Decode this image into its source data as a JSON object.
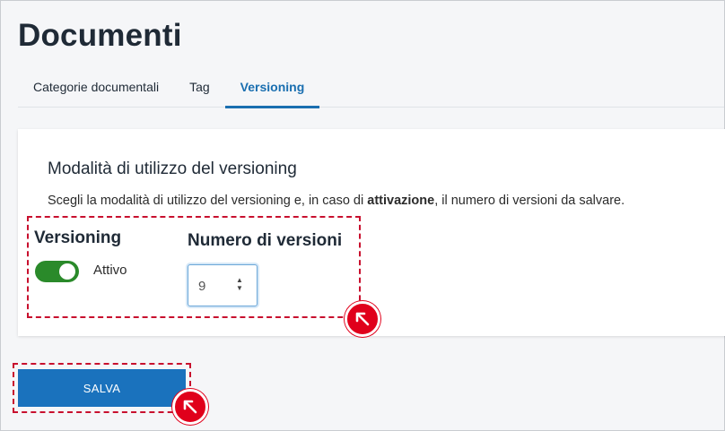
{
  "page": {
    "title": "Documenti"
  },
  "tabs": [
    {
      "label": "Categorie documentali",
      "active": false
    },
    {
      "label": "Tag",
      "active": false
    },
    {
      "label": "Versioning",
      "active": true
    }
  ],
  "card": {
    "title": "Modalità di utilizzo del versioning",
    "description_pre": "Scegli la modalità di utilizzo del versioning e, in caso di ",
    "description_bold": "attivazione",
    "description_post": ", il numero di versioni da salvare."
  },
  "versioning": {
    "label": "Versioning",
    "toggle_state": "on",
    "toggle_label": "Attivo"
  },
  "versions": {
    "label": "Numero di versioni",
    "value": "9"
  },
  "actions": {
    "save_label": "SALVA"
  },
  "icons": {
    "marker": "arrow-up-left-icon"
  },
  "colors": {
    "accent": "#1a72bd",
    "toggle_on": "#2a8a2a",
    "highlight": "#e0001b"
  }
}
